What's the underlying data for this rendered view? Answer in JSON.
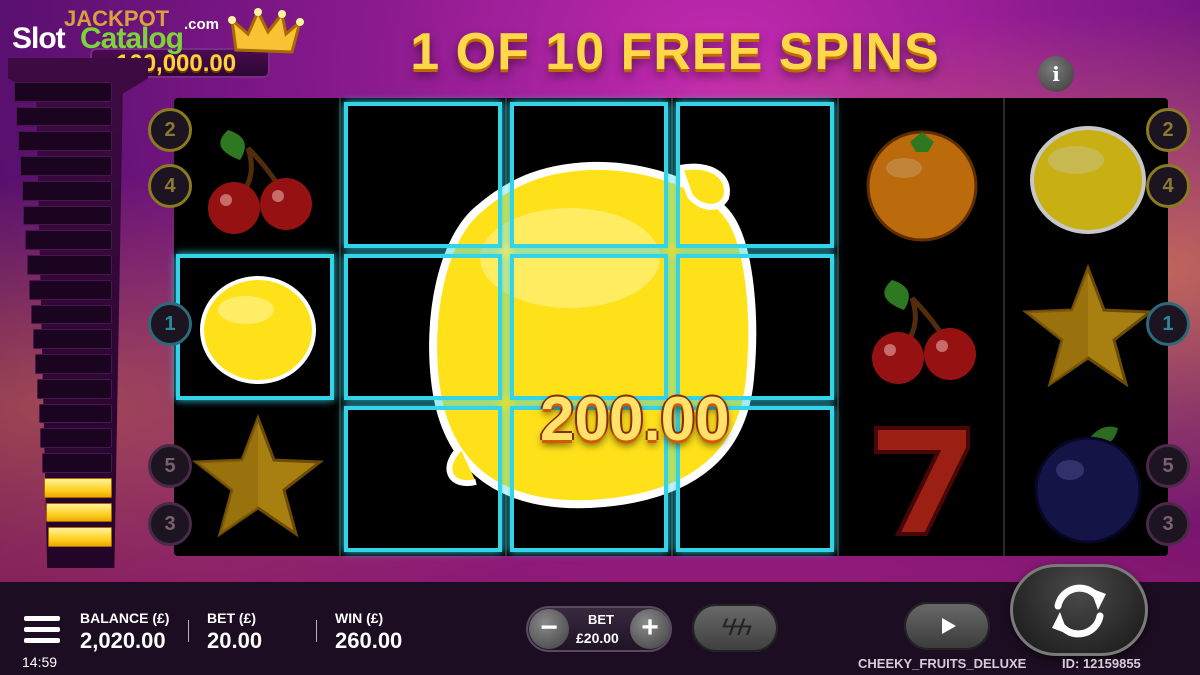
{
  "watermark": {
    "slot": "Slot",
    "catalog": "Catalog",
    "com": ".com"
  },
  "jackpot": {
    "label": "JACKPOT",
    "value": "100,000.00"
  },
  "title": "1 OF 10 FREE SPINS",
  "info_label": "i",
  "ladder": {
    "total_rungs": 19,
    "lit_rungs": 3
  },
  "reels": {
    "columns": [
      [
        "cherry",
        "lemon",
        "star"
      ],
      [
        "lemon",
        "lemon",
        "lemon"
      ],
      [
        "lemon",
        "lemon",
        "lemon"
      ],
      [
        "lemon",
        "lemon",
        "lemon"
      ],
      [
        "orange",
        "cherry",
        "seven"
      ],
      [
        "lemon",
        "star",
        "plum"
      ]
    ],
    "highlighted": [
      [
        0,
        1
      ],
      [
        1,
        0
      ],
      [
        1,
        1
      ],
      [
        1,
        2
      ],
      [
        2,
        0
      ],
      [
        2,
        1
      ],
      [
        2,
        2
      ],
      [
        3,
        0
      ],
      [
        3,
        1
      ],
      [
        3,
        2
      ]
    ]
  },
  "win_amount": "200.00",
  "paylines": {
    "left": [
      "2",
      "4",
      "1",
      "5",
      "3"
    ],
    "right": [
      "2",
      "4",
      "1",
      "5",
      "3"
    ]
  },
  "bottom_bar": {
    "balance_label": "BALANCE (£)",
    "balance_value": "2,020.00",
    "bet_label": "BET (£)",
    "bet_value": "20.00",
    "win_label": "WIN (£)",
    "win_value": "260.00",
    "time": "14:59",
    "bet_control_label": "BET",
    "bet_control_value": "£20.00",
    "minus": "−",
    "plus": "+",
    "turbo_glyph": "ϟϟϟ",
    "game_name": "CHEEKY_FRUITS_DELUXE",
    "game_id": "ID: 12159855"
  },
  "colors": {
    "highlight": "#34d4e8",
    "title": "#ffd84a",
    "jackpot": "#ffd23c"
  }
}
